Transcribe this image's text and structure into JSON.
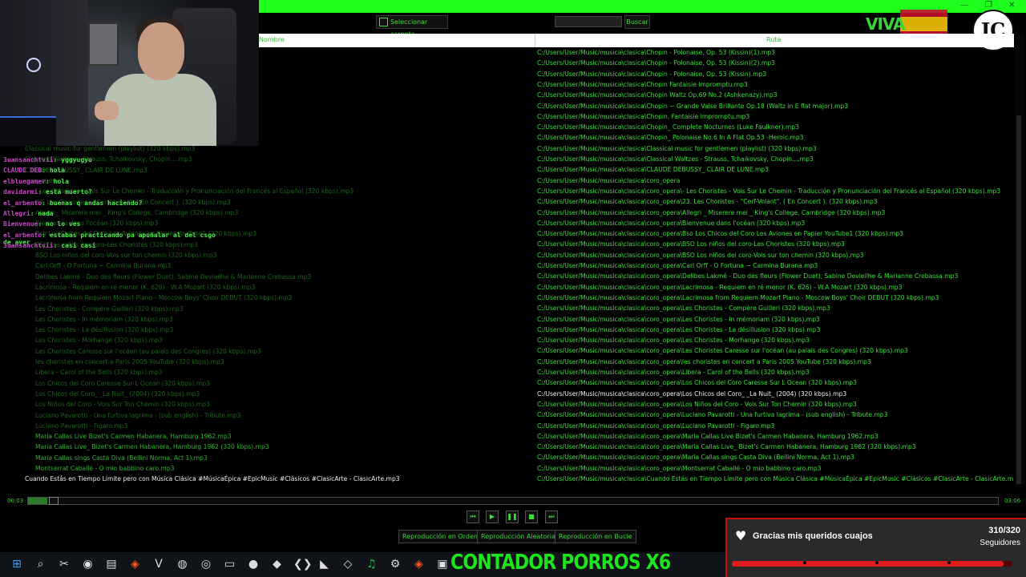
{
  "toolbar": {
    "select_folder_label": "Seleccionar carpeta",
    "search_value": "",
    "search_label": "Buscar"
  },
  "logos": {
    "viva": "VIVA VOX",
    "jc": "JC"
  },
  "table": {
    "col_name": "Nombre",
    "col_path": "Ruta"
  },
  "left_rows": [
    {
      "text": "",
      "y": 0
    },
    {
      "text": "Classical music for gentlemen (playlist) (320 kbps).mp3",
      "x": 31
    },
    {
      "text": "Classical Waltzes - Strauss, Tchaikovsky, Chopin....mp3",
      "x": 31
    },
    {
      "text": "CLAUDE DEBUSSY_ CLAIR DE LUNE.mp3",
      "x": 31
    },
    {
      "text": "coro_opera",
      "x": 31
    },
    {
      "text": "- Les Choristes - Vois Sur Le Chemin - Traducción y Pronunciación del Francés al Español (320 kbps).mp3",
      "x": 44
    },
    {
      "text": "23. Les Choristes - \"Cerf-Volant\". ( En Concert ). (320 kbps).mp3",
      "x": 44
    },
    {
      "text": "Allegri _ Miserere mei _ King's College, Cambridge (320 kbps).mp3",
      "x": 44
    },
    {
      "text": "Bienvenue dans l'océan (320 kbps).mp3",
      "x": 44
    },
    {
      "text": "Bso Los Chicos del Coro Les Aviones en Papier YouTube1 (320 kbps).mp3",
      "x": 44
    },
    {
      "text": "BSO Los niños del coro-Les Choristes (320 kbps).mp3",
      "x": 44
    },
    {
      "text": "BSO Los niños del coro-Vois sur ton chemin (320 kbps).mp3",
      "x": 44
    },
    {
      "text": "Carl Orff - O Fortuna ~ Carmina Burana.mp3",
      "x": 44
    },
    {
      "text": "Delibes Lakmé - Duo des fleurs (Flower Duet), Sabine Devieilhe & Marianne Crebassa.mp3",
      "x": 44
    },
    {
      "text": "Lacrimosa - Requiem en ré menor (K. 626) - W.A Mozart (320 kbps).mp3",
      "x": 44
    },
    {
      "text": "Lacrimosa from Requiem Mozart Piano - Moscow Boys' Choir DEBUT (320 kbps).mp3",
      "x": 44
    },
    {
      "text": "Les Choristes - Compère Guilleri (320 kbps).mp3",
      "x": 44
    },
    {
      "text": "Les Choristes - In mémoriam (320 kbps).mp3",
      "x": 44
    },
    {
      "text": "Les Choristes - La désillusion (320 kbps).mp3",
      "x": 44
    },
    {
      "text": "Les Choristes - Morhange (320 kbps).mp3",
      "x": 44
    },
    {
      "text": "Les Choristes Caresse sur l'océan (au palais des Congres) (320 kbps).mp3",
      "x": 44
    },
    {
      "text": "les choristes en concert a Paris 2005 YouTube (320 kbps).mp3",
      "x": 44
    },
    {
      "text": "Libera - Carol of the Bells (320 kbps).mp3",
      "x": 44
    },
    {
      "text": "Los Chicos del Coro Caresse Sur L Ocean (320 kbps).mp3",
      "x": 44
    },
    {
      "text": "Los Chicos del Coro_ _La Nuit_ (2004) (320 kbps).mp3",
      "x": 44
    },
    {
      "text": "Los Niños del Coro - Vois Sur Ton Chemin (320 kbps).mp3",
      "x": 44
    },
    {
      "text": "Luciano Pavarotti - Una furtiva lagrima - (sub english) - Tribute.mp3",
      "x": 44
    },
    {
      "text": "Luciano Pavarotti - Figaro.mp3",
      "x": 44
    },
    {
      "text": "Maria Callas Live Bizet's Carmen Habanera, Hamburg 1962.mp3",
      "x": 44
    },
    {
      "text": "Maria Callas Live_ Bizet's Carmen Habanera, Hamburg 1962 (320 kbps).mp3",
      "x": 44
    },
    {
      "text": "Maria Callas sings Casta Diva (Bellini Norma, Act 1).mp3",
      "x": 44
    },
    {
      "text": "Montserrat Caballé - O mio babbino caro.mp3",
      "x": 44
    },
    {
      "text": "Cuando Estás en Tiempo Límite pero con Música Clásica #MúsicaÉpica #EpicMusic #Clásicos #ClasicArte - ClasicArte.mp3",
      "x": 31
    }
  ],
  "right_rows": [
    "C:/Users/User/Music/musica\\clasica\\Chopin - Polonaise, Op. 53 (Kissin)(1).mp3",
    "C:/Users/User/Music/musica\\clasica\\Chopin - Polonaise, Op. 53 (Kissin)(2).mp3",
    "C:/Users/User/Music/musica\\clasica\\Chopin - Polonaise, Op. 53 (Kissin).mp3",
    "C:/Users/User/Music/musica\\clasica\\Chopin Fantaisie Impromptu.mp3",
    "C:/Users/User/Music/musica\\clasica\\Chopin Waltz Op.69 No.2 (Ashkenazy).mp3",
    "C:/Users/User/Music/musica\\clasica\\Chopin ~ Grande Valse Brillante Op.18 (Waltz in E flat major).mp3",
    "C:/Users/User/Music/musica\\clasica\\Chopin, Fantaisie Impromptu.mp3",
    "C:/Users/User/Music/musica\\clasica\\Chopin_ Complete Nocturnes (Luke Faulkner).mp3",
    "C:/Users/User/Music/musica\\clasica\\Chopin_ Polonaise No.6 In A Flat Op.53 -Heroic.mp3",
    "C:/Users/User/Music/musica\\clasica\\Classical music for gentlemen (playlist) (320 kbps).mp3",
    "C:/Users/User/Music/musica\\clasica\\Classical Waltzes - Strauss, Tchaikovsky, Chopin....mp3",
    "C:/Users/User/Music/musica\\clasica\\CLAUDE DEBUSSY_ CLAIR DE LUNE.mp3",
    "C:/Users/User/Music/musica\\clasica\\coro_opera",
    "C:/Users/User/Music/musica\\clasica\\coro_opera\\- Les Choristes - Vois Sur Le Chemin - Traducción y Pronunciación del Francés al Español (320 kbps).mp3",
    "C:/Users/User/Music/musica\\clasica\\coro_opera\\23. Les Choristes - \"Cerf-Volant\". ( En Concert ). (320 kbps).mp3",
    "C:/Users/User/Music/musica\\clasica\\coro_opera\\Allegri _ Miserere mei _ King's College, Cambridge (320 kbps).mp3",
    "C:/Users/User/Music/musica\\clasica\\coro_opera\\Bienvenue dans l'océan (320 kbps).mp3",
    "C:/Users/User/Music/musica\\clasica\\coro_opera\\Bso Los Chicos del Coro Les Aviones en Papier YouTube1 (320 kbps).mp3",
    "C:/Users/User/Music/musica\\clasica\\coro_opera\\BSO Los niños del coro-Les Choristes (320 kbps).mp3",
    "C:/Users/User/Music/musica\\clasica\\coro_opera\\BSO Los niños del coro-Vois sur ton chemin (320 kbps).mp3",
    "C:/Users/User/Music/musica\\clasica\\coro_opera\\Carl Orff - O Fortuna ~ Carmina Burana.mp3",
    "C:/Users/User/Music/musica\\clasica\\coro_opera\\Delibes Lakmé - Duo des fleurs (Flower Duet), Sabine Devieilhe & Marianne Crebassa.mp3",
    "C:/Users/User/Music/musica\\clasica\\coro_opera\\Lacrimosa - Requiem en ré menor (K. 626) - W.A Mozart (320 kbps).mp3",
    "C:/Users/User/Music/musica\\clasica\\coro_opera\\Lacrimosa from Requiem Mozart Piano - Moscow Boys' Choir DEBUT (320 kbps).mp3",
    "C:/Users/User/Music/musica\\clasica\\coro_opera\\Les Choristes - Compère Guilleri (320 kbps).mp3",
    "C:/Users/User/Music/musica\\clasica\\coro_opera\\Les Choristes - In mémoriam (320 kbps).mp3",
    "C:/Users/User/Music/musica\\clasica\\coro_opera\\Les Choristes - La désillusion (320 kbps).mp3",
    "C:/Users/User/Music/musica\\clasica\\coro_opera\\Les Choristes - Morhange (320 kbps).mp3",
    "C:/Users/User/Music/musica\\clasica\\coro_opera\\Les Choristes Caresse sur l'océan (au palais des Congres) (320 kbps).mp3",
    "C:/Users/User/Music/musica\\clasica\\coro_opera\\les choristes en concert a Paris 2005 YouTube (320 kbps).mp3",
    "C:/Users/User/Music/musica\\clasica\\coro_opera\\Libera - Carol of the Bells (320 kbps).mp3",
    "C:/Users/User/Music/musica\\clasica\\coro_opera\\Los Chicos del Coro Caresse Sur L Ocean (320 kbps).mp3",
    "C:/Users/User/Music/musica\\clasica\\coro_opera\\Los Chicos del Coro_ _La Nuit_ (2004) (320 kbps).mp3",
    "C:/Users/User/Music/musica\\clasica\\coro_opera\\Los Niños del Coro - Vois Sur Ton Chemin (320 kbps).mp3",
    "C:/Users/User/Music/musica\\clasica\\coro_opera\\Luciano Pavarotti - Una furtiva lagrima - (sub english) - Tribute.mp3",
    "C:/Users/User/Music/musica\\clasica\\coro_opera\\Luciano Pavarotti - Figaro.mp3",
    "C:/Users/User/Music/musica\\clasica\\coro_opera\\Maria Callas Live Bizet's Carmen Habanera, Hamburg 1962.mp3",
    "C:/Users/User/Music/musica\\clasica\\coro_opera\\Maria Callas Live_ Bizet's Carmen Habanera, Hamburg 1962 (320 kbps).mp3",
    "C:/Users/User/Music/musica\\clasica\\coro_opera\\Maria Callas sings Casta Diva (Bellini Norma, Act 1).mp3",
    "C:/Users/User/Music/musica\\clasica\\coro_opera\\Montserrat Caballé - O mio babbino caro.mp3",
    "C:/Users/User/Music/musica\\clasica\\Cuando Estás en Tiempo Límite pero con Música Clásica #MúsicaÉpica #EpicMusic #Clásicos #ClasicArte - ClasicArte.mp3"
  ],
  "highlighted_index": 32,
  "chat": [
    {
      "user": "3uansanchtvii",
      "text": "yggyugyu"
    },
    {
      "user": "CLAUDE DEB",
      "text": "hola"
    },
    {
      "user": "elbluegamer",
      "text": "hola"
    },
    {
      "user": "davidarmi",
      "text": "está muerto?"
    },
    {
      "user": "el_arbento",
      "text": "buenas q andas haciendo?"
    },
    {
      "user": "Allegri",
      "text": "nada"
    },
    {
      "user": "Bienvenue",
      "text": "no lo ves"
    },
    {
      "user": "el_arbento",
      "text": "estabas practicando pa apuñalar al del csgo de ayer"
    },
    {
      "user": "3uansanchtvii",
      "text": "casi casi"
    }
  ],
  "player": {
    "time_now": "00:03",
    "time_total": "03:06",
    "progress": 0.02,
    "controls": [
      "previous",
      "play",
      "pause",
      "stop",
      "next"
    ],
    "modes": [
      "Reproducción en Orden",
      "Reproducción Aleatoria",
      "Reproducción en Bucle"
    ]
  },
  "alert": {
    "message": "Gracias mis queridos cuajos",
    "count": "310/320",
    "label": "Seguidores",
    "progress": 0.969
  },
  "counter_text": "CONTADOR PORROS X6",
  "taskbar_icons": [
    "windows-icon",
    "search-icon",
    "capcut-icon",
    "edge-icon",
    "files-icon",
    "brave-icon",
    "vivaldi-icon",
    "discord-icon",
    "chrome-icon",
    "folder-icon",
    "obs-icon",
    "box-icon",
    "vscode-icon",
    "epic-icon",
    "unity-icon",
    "spotify-icon",
    "steam-icon",
    "brave2-icon",
    "terminal-icon"
  ],
  "colors": {
    "accent": "#1dff1d",
    "alert_red": "#e11b1b"
  }
}
